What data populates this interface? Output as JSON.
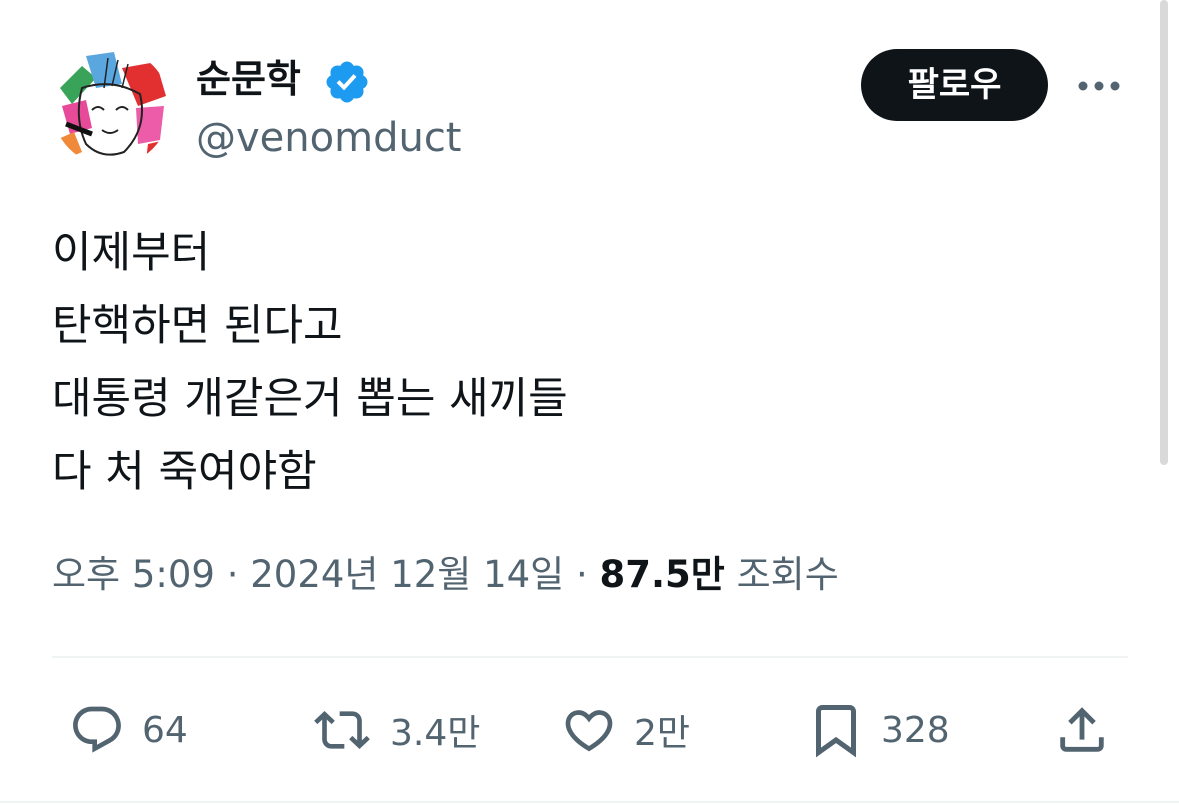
{
  "author": {
    "display_name": "순문학",
    "handle": "@venomduct",
    "verified": true
  },
  "follow_label": "팔로우",
  "more_icon": "more-horizontal-icon",
  "tweet": {
    "lines": [
      "이제부터",
      "탄핵하면 된다고",
      "대통령 개같은거 뽑는 새끼들",
      "다 처 죽여야함"
    ]
  },
  "meta": {
    "time": "오후 5:09",
    "separator": "·",
    "date": "2024년 12월 14일",
    "views_count": "87.5만",
    "views_label": "조회수"
  },
  "actions": {
    "reply": {
      "icon": "reply-icon",
      "count": "64"
    },
    "retweet": {
      "icon": "retweet-icon",
      "count": "3.4만"
    },
    "like": {
      "icon": "heart-icon",
      "count": "2만"
    },
    "bookmark": {
      "icon": "bookmark-icon",
      "count": "328"
    },
    "share": {
      "icon": "share-icon"
    }
  },
  "colors": {
    "text_primary": "#0f1419",
    "text_secondary": "#536471",
    "verified_blue": "#1d9bf0",
    "follow_bg": "#0f1419",
    "divider": "#eff3f4"
  }
}
